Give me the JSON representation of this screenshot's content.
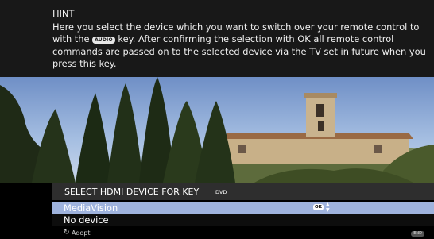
{
  "hint": {
    "title": "HINT",
    "text_before_key": "Here you select the device which you want to switch over your remote control to with the",
    "key_badge": "AUDIO",
    "text_after_key": "key. After confirming the selection with OK all remote control commands are passed on to the selected device via the TV set in future when you press this key."
  },
  "menu": {
    "title": "SELECT HDMI DEVICE FOR KEY",
    "key_name": "DVD",
    "options": [
      {
        "label": "MediaVision",
        "selected": true
      },
      {
        "label": "No device",
        "selected": false
      }
    ],
    "ok_badge": "OK",
    "updown_icon": "up-down-arrows-icon",
    "footer_icon": "adopt-circle-icon",
    "footer_label": "Adopt",
    "end_badge": "END"
  },
  "colors": {
    "hint_bg": "#181818",
    "header_bg": "#2e2e2e",
    "selection_bg": "#9fb3dd"
  }
}
